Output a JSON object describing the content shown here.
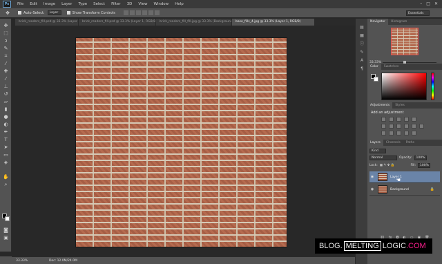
{
  "menubar": {
    "logo": "Ps",
    "items": [
      "File",
      "Edit",
      "Image",
      "Layer",
      "Type",
      "Select",
      "Filter",
      "3D",
      "View",
      "Window",
      "Help"
    ],
    "window_controls": [
      "–",
      "□",
      "✕"
    ]
  },
  "options": {
    "auto_select_label": "Auto-Select:",
    "auto_select_value": "Layer",
    "show_transform_label": "Show Transform Controls",
    "workspace": "Essentials"
  },
  "tabs": [
    {
      "label": "brick_readers_fill.psd @ 33.3% (Layer 1, RGB/8*)",
      "active": false
    },
    {
      "label": "brick_readers_fill.psd @ 33.3% (Layer 1, RGB/8)",
      "active": false
    },
    {
      "label": "brick_readers_fill_fill.jpg @ 33.3% (Background, RGB/8)",
      "active": false
    },
    {
      "label": "base_fills_4.jpg @ 33.3% (Layer 1, RGB/8)",
      "active": true
    }
  ],
  "status": {
    "zoom": "33.33%",
    "doc": "Doc: 12.0M/24.0M"
  },
  "navigator": {
    "tabs": [
      "Navigator",
      "Histogram"
    ],
    "zoom": "33.33%"
  },
  "color": {
    "tabs": [
      "Color",
      "Swatches"
    ],
    "fg": "#000000",
    "bg": "#ffffff"
  },
  "adjustments": {
    "tabs": [
      "Adjustments",
      "Styles"
    ],
    "title": "Add an adjustment"
  },
  "layers": {
    "tabs": [
      "Layers",
      "Channels",
      "Paths"
    ],
    "kind_label": "Kind",
    "blend": "Normal",
    "opacity_label": "Opacity:",
    "opacity": "100%",
    "lock_label": "Lock:",
    "fill_label": "Fill:",
    "fill": "100%",
    "items": [
      {
        "name": "Layer 1",
        "selected": true
      },
      {
        "name": "Background",
        "selected": false
      }
    ],
    "footer_icons": [
      "link",
      "fx",
      "mask",
      "adjust",
      "folder",
      "new",
      "trash"
    ]
  },
  "watermark": {
    "part1": "BLOG.",
    "part2": "MELTING",
    "part3": "LOGIC",
    "part4": ".COM"
  }
}
